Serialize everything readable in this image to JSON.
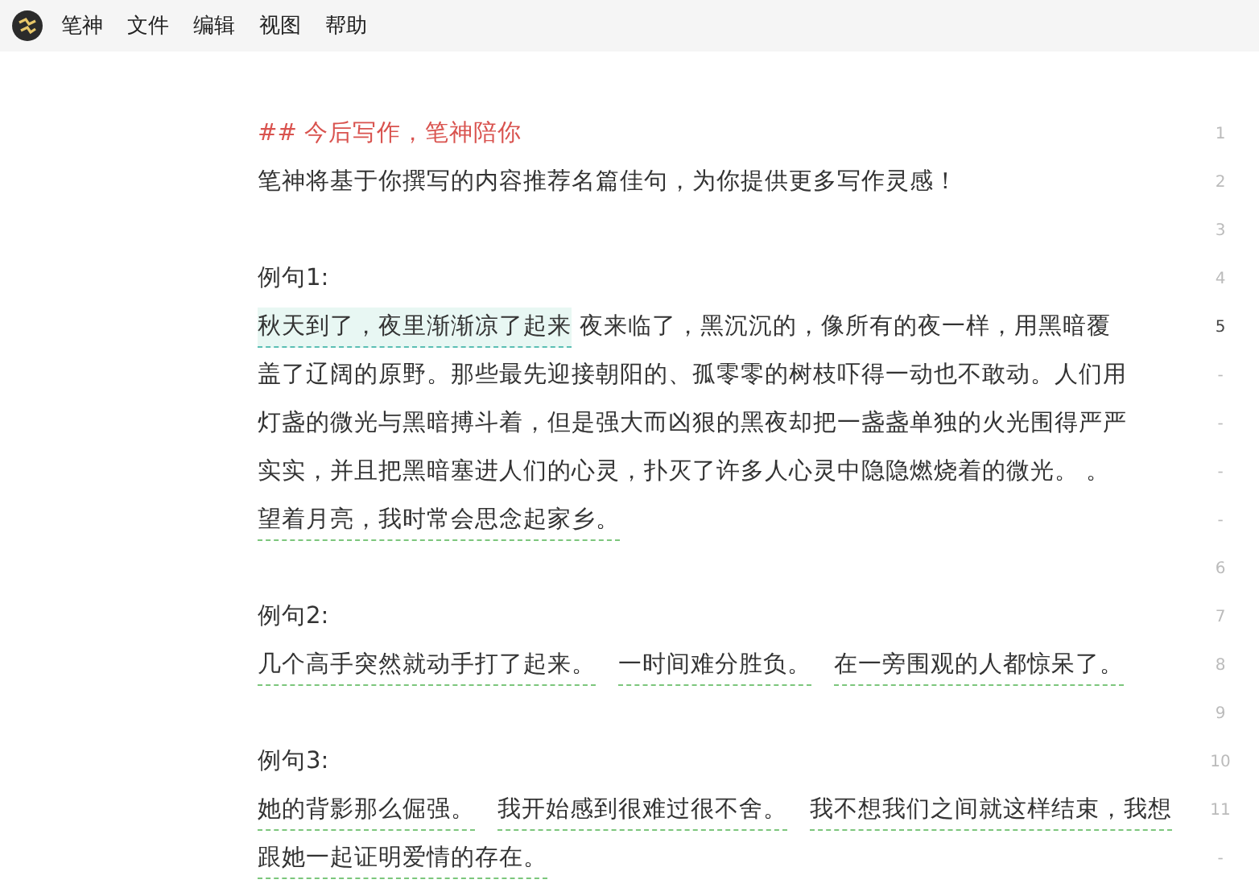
{
  "menu": [
    {
      "label": "笔神"
    },
    {
      "label": "文件"
    },
    {
      "label": "编辑"
    },
    {
      "label": "视图"
    },
    {
      "label": "帮助"
    }
  ],
  "rows": [
    {
      "gutter": "1",
      "current": false,
      "segments": [
        {
          "kind": "heading",
          "text": "## 今后写作，笔神陪你"
        }
      ]
    },
    {
      "gutter": "2",
      "current": false,
      "segments": [
        {
          "kind": "plain",
          "text": "笔神将基于你撰写的内容推荐名篇佳句，为你提供更多写作灵感！"
        }
      ]
    },
    {
      "gutter": "3",
      "current": false,
      "segments": []
    },
    {
      "gutter": "4",
      "current": false,
      "segments": [
        {
          "kind": "plain",
          "text": "例句1:"
        }
      ]
    },
    {
      "gutter": "5",
      "current": true,
      "segments": [
        {
          "kind": "highlighted",
          "text": "秋天到了，夜里渐渐凉了起来"
        },
        {
          "kind": "plain",
          "text": "夜来临了，黑沉沉的，像所有的夜一样，用黑暗覆"
        }
      ]
    },
    {
      "gutter": "-",
      "current": false,
      "segments": [
        {
          "kind": "plain",
          "text": "盖了辽阔的原野。那些最先迎接朝阳的、孤零零的树枝吓得一动也不敢动。人们用"
        }
      ]
    },
    {
      "gutter": "-",
      "current": false,
      "segments": [
        {
          "kind": "plain",
          "text": "灯盏的微光与黑暗搏斗着，但是强大而凶狠的黑夜却把一盏盏单独的火光围得严严"
        }
      ]
    },
    {
      "gutter": "-",
      "current": false,
      "segments": [
        {
          "kind": "plain",
          "text": "实实，并且把黑暗塞进人们的心灵，扑灭了许多人心灵中隐隐燃烧着的微光。 。"
        }
      ]
    },
    {
      "gutter": "-",
      "current": false,
      "segments": [
        {
          "kind": "suggested",
          "text": "望着月亮，我时常会思念起家乡。"
        }
      ]
    },
    {
      "gutter": "6",
      "current": false,
      "segments": []
    },
    {
      "gutter": "7",
      "current": false,
      "segments": [
        {
          "kind": "plain",
          "text": "例句2:"
        }
      ]
    },
    {
      "gutter": "8",
      "current": false,
      "segments": [
        {
          "kind": "suggested",
          "text": "几个高手突然就动手打了起来。"
        },
        {
          "kind": "suggested",
          "text": "一时间难分胜负。"
        },
        {
          "kind": "suggested",
          "text": "在一旁围观的人都惊呆了。"
        }
      ]
    },
    {
      "gutter": "9",
      "current": false,
      "segments": []
    },
    {
      "gutter": "10",
      "current": false,
      "segments": [
        {
          "kind": "plain",
          "text": "例句3:"
        }
      ]
    },
    {
      "gutter": "11",
      "current": false,
      "segments": [
        {
          "kind": "suggested",
          "text": "她的背影那么倔强。"
        },
        {
          "kind": "suggested",
          "text": "我开始感到很难过很不舍。"
        },
        {
          "kind": "suggested",
          "text": "我不想我们之间就这样结束，我想"
        }
      ]
    },
    {
      "gutter": "-",
      "current": false,
      "segments": [
        {
          "kind": "suggested",
          "text": "跟她一起证明爱情的存在。"
        }
      ]
    }
  ]
}
